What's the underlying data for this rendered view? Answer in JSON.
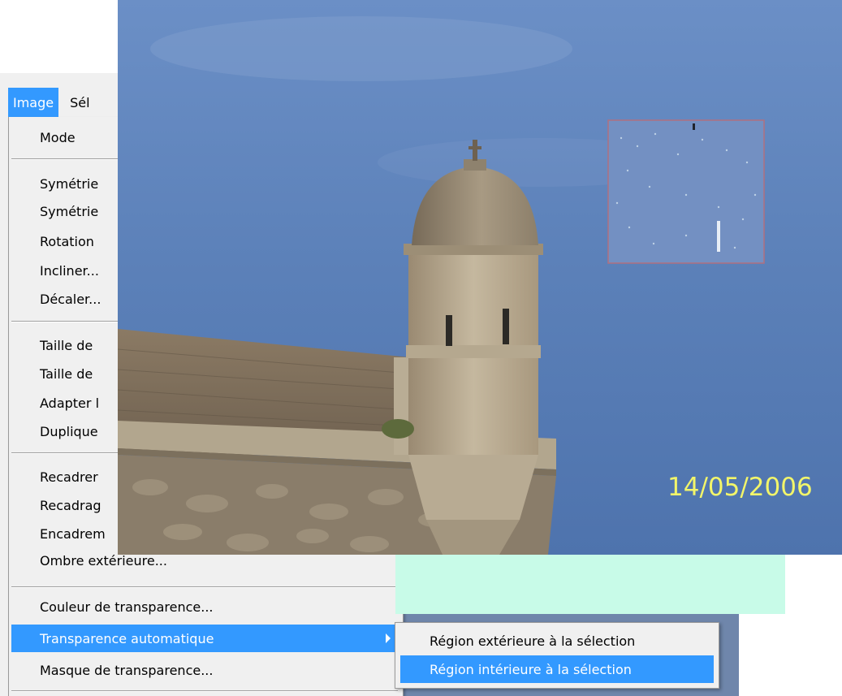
{
  "menubar": {
    "active_label": "Image",
    "next_label": "Sél"
  },
  "menu": {
    "items": [
      {
        "label": "Mode"
      },
      {
        "label": "Symétrie"
      },
      {
        "label": "Symétrie"
      },
      {
        "label": "Rotation"
      },
      {
        "label": "Incliner..."
      },
      {
        "label": "Décaler..."
      },
      {
        "label": "Taille de"
      },
      {
        "label": "Taille de"
      },
      {
        "label": "Adapter l"
      },
      {
        "label": "Duplique"
      },
      {
        "label": "Recadrer"
      },
      {
        "label": "Recadrag"
      },
      {
        "label": "Encadrem"
      },
      {
        "label": "Ombre extérieure..."
      },
      {
        "label": "Couleur de transparence..."
      },
      {
        "label": "Transparence automatique"
      },
      {
        "label": "Masque de transparence..."
      }
    ]
  },
  "submenu": {
    "items": [
      {
        "label": "Région extérieure à la sélection"
      },
      {
        "label": "Région intérieure à la sélection"
      }
    ]
  },
  "photo": {
    "date_stamp": "14/05/2006"
  },
  "colors": {
    "highlight": "#3399ff",
    "sky": "#5b7fb3",
    "date_stamp": "#f2f56a",
    "mint_overlay": "#c8fbe8"
  }
}
